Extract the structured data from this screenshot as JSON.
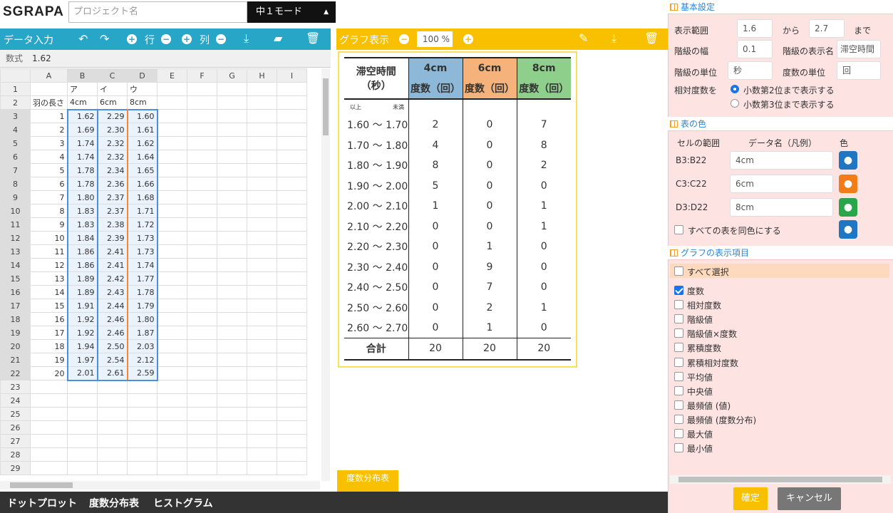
{
  "app": {
    "logo": "SGRAPA",
    "project_placeholder": "プロジェクト名",
    "mode": "中１モード"
  },
  "data_toolbar": {
    "title": "データ入力",
    "row_label": "行",
    "col_label": "列"
  },
  "formula": {
    "label": "数式",
    "value": "1.62"
  },
  "spreadsheet": {
    "columns": [
      "A",
      "B",
      "C",
      "D",
      "E",
      "F",
      "G",
      "H",
      "I"
    ],
    "row1": [
      "",
      "ア",
      "イ",
      "ウ"
    ],
    "row2": [
      "羽の長さ",
      "4cm",
      "6cm",
      "8cm"
    ],
    "data": [
      [
        "1",
        "1.62",
        "2.29",
        "1.60"
      ],
      [
        "2",
        "1.69",
        "2.30",
        "1.61"
      ],
      [
        "3",
        "1.74",
        "2.32",
        "1.62"
      ],
      [
        "4",
        "1.74",
        "2.32",
        "1.64"
      ],
      [
        "5",
        "1.78",
        "2.34",
        "1.65"
      ],
      [
        "6",
        "1.78",
        "2.36",
        "1.66"
      ],
      [
        "7",
        "1.80",
        "2.37",
        "1.68"
      ],
      [
        "8",
        "1.83",
        "2.37",
        "1.71"
      ],
      [
        "9",
        "1.83",
        "2.38",
        "1.72"
      ],
      [
        "10",
        "1.84",
        "2.39",
        "1.73"
      ],
      [
        "11",
        "1.86",
        "2.41",
        "1.73"
      ],
      [
        "12",
        "1.86",
        "2.41",
        "1.74"
      ],
      [
        "13",
        "1.89",
        "2.42",
        "1.77"
      ],
      [
        "14",
        "1.89",
        "2.43",
        "1.78"
      ],
      [
        "15",
        "1.91",
        "2.44",
        "1.79"
      ],
      [
        "16",
        "1.92",
        "2.46",
        "1.80"
      ],
      [
        "17",
        "1.92",
        "2.46",
        "1.87"
      ],
      [
        "18",
        "1.94",
        "2.50",
        "2.03"
      ],
      [
        "19",
        "1.97",
        "2.54",
        "2.12"
      ],
      [
        "20",
        "2.01",
        "2.61",
        "2.59"
      ]
    ],
    "row_numbers": [
      "1",
      "2",
      "3",
      "4",
      "5",
      "6",
      "7",
      "8",
      "9",
      "10",
      "11",
      "12",
      "13",
      "14",
      "15",
      "16",
      "17",
      "18",
      "19",
      "20",
      "21",
      "22",
      "23",
      "24",
      "25",
      "26",
      "27",
      "28",
      "29"
    ]
  },
  "graph_toolbar": {
    "title": "グラフ表示",
    "zoom": "100",
    "zoom_unit": "%"
  },
  "freq_table": {
    "header_class": "滞空時間",
    "header_unit": "（秒）",
    "series": [
      {
        "name": "4cm",
        "color": "#8db8d8"
      },
      {
        "name": "6cm",
        "color": "#f5b27a"
      },
      {
        "name": "8cm",
        "color": "#8fcf8c"
      }
    ],
    "freq_label": "度数（回）",
    "lower_label": "以上",
    "upper_label": "未満",
    "tilde": "～",
    "rows": [
      {
        "from": "1.60",
        "to": "1.70",
        "v": [
          "2",
          "0",
          "7"
        ]
      },
      {
        "from": "1.70",
        "to": "1.80",
        "v": [
          "4",
          "0",
          "8"
        ]
      },
      {
        "from": "1.80",
        "to": "1.90",
        "v": [
          "8",
          "0",
          "2"
        ]
      },
      {
        "from": "1.90",
        "to": "2.00",
        "v": [
          "5",
          "0",
          "0"
        ]
      },
      {
        "from": "2.00",
        "to": "2.10",
        "v": [
          "1",
          "0",
          "1"
        ]
      },
      {
        "from": "2.10",
        "to": "2.20",
        "v": [
          "0",
          "0",
          "1"
        ]
      },
      {
        "from": "2.20",
        "to": "2.30",
        "v": [
          "0",
          "1",
          "0"
        ]
      },
      {
        "from": "2.30",
        "to": "2.40",
        "v": [
          "0",
          "9",
          "0"
        ]
      },
      {
        "from": "2.40",
        "to": "2.50",
        "v": [
          "0",
          "7",
          "0"
        ]
      },
      {
        "from": "2.50",
        "to": "2.60",
        "v": [
          "0",
          "2",
          "1"
        ]
      },
      {
        "from": "2.60",
        "to": "2.70",
        "v": [
          "0",
          "1",
          "0"
        ]
      }
    ],
    "total_label": "合計",
    "totals": [
      "20",
      "20",
      "20"
    ]
  },
  "graph_tab": "度数分布表",
  "bottom_tabs": [
    "ドットプロット",
    "度数分布表",
    "ヒストグラム"
  ],
  "settings": {
    "basic": {
      "title": "基本設定",
      "range_label": "表示範囲",
      "range_from": "1.6",
      "from_label": "から",
      "range_to": "2.7",
      "to_label": "まで",
      "width_label": "階級の幅",
      "width_value": "0.1",
      "class_name_label": "階級の表示名",
      "class_name_value": "滞空時間",
      "class_unit_label": "階級の単位",
      "class_unit_value": "秒",
      "freq_unit_label": "度数の単位",
      "freq_unit_value": "回",
      "relative_label": "相対度数を",
      "relative_opt1": "小数第2位まで表示する",
      "relative_opt2": "小数第3位まで表示する"
    },
    "colors": {
      "title": "表の色",
      "col_range": "セルの範囲",
      "col_name": "データ名（凡例）",
      "col_color": "色",
      "rows": [
        {
          "range": "B3:B22",
          "name": "4cm",
          "color": "#2176c4"
        },
        {
          "range": "C3:C22",
          "name": "6cm",
          "color": "#f07c1a"
        },
        {
          "range": "D3:D22",
          "name": "8cm",
          "color": "#2aa64a"
        }
      ],
      "same_color_label": "すべての表を同色にする",
      "same_color_color": "#2176c4"
    },
    "items": {
      "title": "グラフの表示項目",
      "select_all": "すべて選択",
      "list": [
        {
          "label": "度数",
          "checked": true
        },
        {
          "label": "相対度数",
          "checked": false
        },
        {
          "label": "階級値",
          "checked": false
        },
        {
          "label": "階級値×度数",
          "checked": false
        },
        {
          "label": "累積度数",
          "checked": false
        },
        {
          "label": "累積相対度数",
          "checked": false
        },
        {
          "label": "平均値",
          "checked": false
        },
        {
          "label": "中央値",
          "checked": false
        },
        {
          "label": "最頻値 (値)",
          "checked": false
        },
        {
          "label": "最頻値 (度数分布)",
          "checked": false
        },
        {
          "label": "最大値",
          "checked": false
        },
        {
          "label": "最小値",
          "checked": false
        }
      ]
    },
    "ok_label": "確定",
    "cancel_label": "キャンセル"
  }
}
